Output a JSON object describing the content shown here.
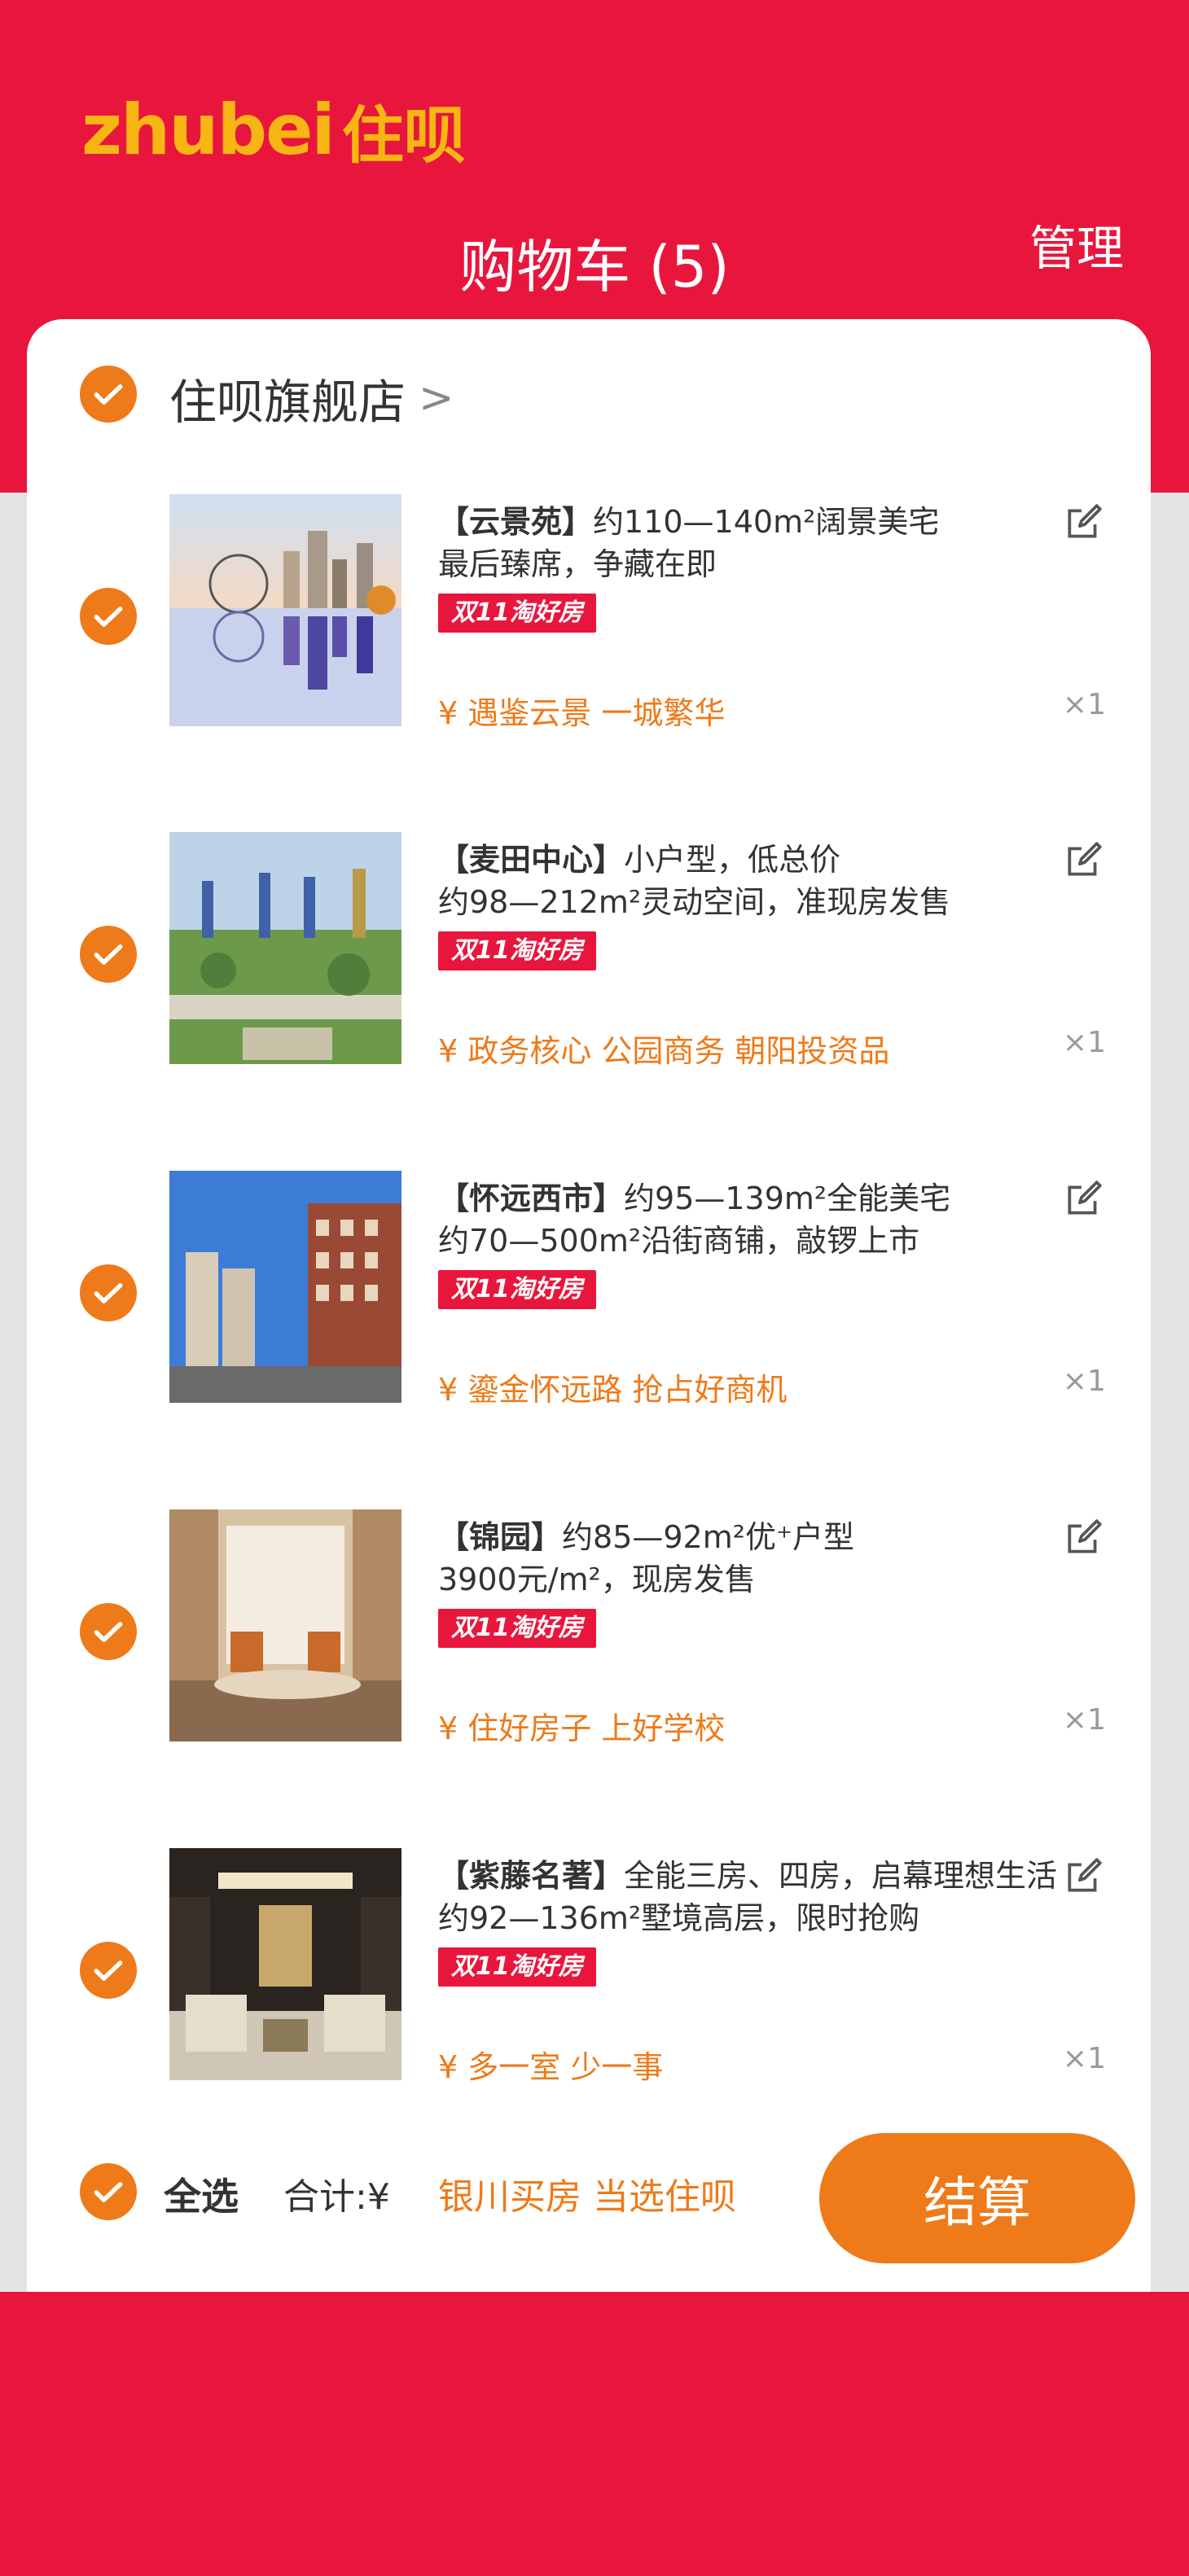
{
  "brand": {
    "logo_latin": "zhubei",
    "logo_cn": "住呗"
  },
  "header": {
    "title": "购物车 (5)",
    "manage_label": "管理"
  },
  "store": {
    "name": "住呗旗舰店",
    "chevron": ">"
  },
  "colors": {
    "brand_red": "#e8163d",
    "accent_orange": "#ee7a1a",
    "logo_yellow": "#f7b614"
  },
  "items": [
    {
      "name": "【云景苑】",
      "line1_rest": "约110—140m²阔景美宅",
      "line2": "最后臻席，争藏在即",
      "tag": "双11淘好房",
      "price": "¥ 遇鉴云景 一城繁华",
      "qty": "×1"
    },
    {
      "name": "【麦田中心】",
      "line1_rest": "小户型，低总价",
      "line2": "约98—212m²灵动空间，准现房发售",
      "tag": "双11淘好房",
      "price": "¥ 政务核心 公园商务 朝阳投资品",
      "qty": "×1"
    },
    {
      "name": "【怀远西市】",
      "line1_rest": "约95—139m²全能美宅",
      "line2": "约70—500m²沿街商铺，敲锣上市",
      "tag": "双11淘好房",
      "price": "¥ 鎏金怀远路 抢占好商机",
      "qty": "×1"
    },
    {
      "name": "【锦园】",
      "line1_rest": "约85—92m²优⁺户型",
      "line2": "3900元/m²，现房发售",
      "tag": "双11淘好房",
      "price": "¥ 住好房子 上好学校",
      "qty": "×1"
    },
    {
      "name": "【紫藤名著】",
      "line1_rest": "全能三房、四房，启幕理想生活",
      "line2": "约92—136m²墅境高层，限时抢购",
      "tag": "双11淘好房",
      "price": "¥ 多一室 少一事",
      "qty": "×1"
    }
  ],
  "footer": {
    "select_all": "全选",
    "total_label": "合计:¥",
    "slogan": "银川买房 当选住呗",
    "checkout_label": "结算"
  }
}
